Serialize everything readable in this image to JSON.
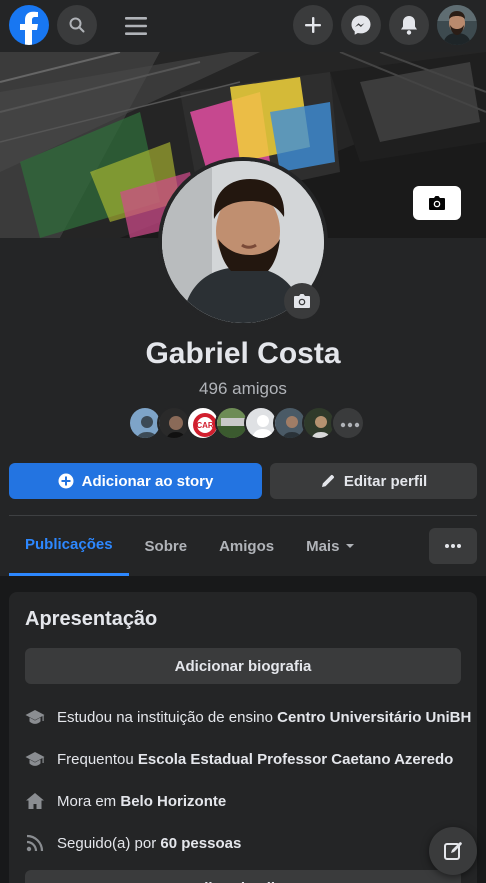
{
  "profile": {
    "name": "Gabriel Costa",
    "friends_count": "496 amigos"
  },
  "actions": {
    "add_story": "Adicionar ao story",
    "edit_profile": "Editar perfil"
  },
  "tabs": [
    {
      "label": "Publicações",
      "active": true
    },
    {
      "label": "Sobre",
      "active": false
    },
    {
      "label": "Amigos",
      "active": false
    },
    {
      "label": "Mais",
      "active": false
    }
  ],
  "intro": {
    "title": "Apresentação",
    "bio_button": "Adicionar biografia",
    "items": [
      {
        "icon": "graduation-cap-icon",
        "prefix": "Estudou na instituição de ensino ",
        "bold": "Centro Universitário UniBH"
      },
      {
        "icon": "graduation-cap-icon",
        "prefix": "Frequentou ",
        "bold": "Escola Estadual Professor Caetano Azeredo"
      },
      {
        "icon": "home-icon",
        "prefix": "Mora em ",
        "bold": "Belo Horizonte"
      },
      {
        "icon": "rss-icon",
        "prefix": "Seguido(a) por ",
        "bold": "60 pessoas"
      }
    ],
    "edit_details": "Editar detalhes"
  },
  "icons": {
    "logo": "facebook-logo",
    "search": "search-icon",
    "menu": "hamburger-menu-icon",
    "create": "plus-icon",
    "messenger": "messenger-icon",
    "notifications": "bell-icon",
    "camera": "camera-icon",
    "more": "ellipsis-icon",
    "compose": "compose-icon"
  },
  "colors": {
    "accent": "#2d88ff",
    "primary_button": "#2374e1",
    "background": "#18191a",
    "surface": "#242526"
  }
}
